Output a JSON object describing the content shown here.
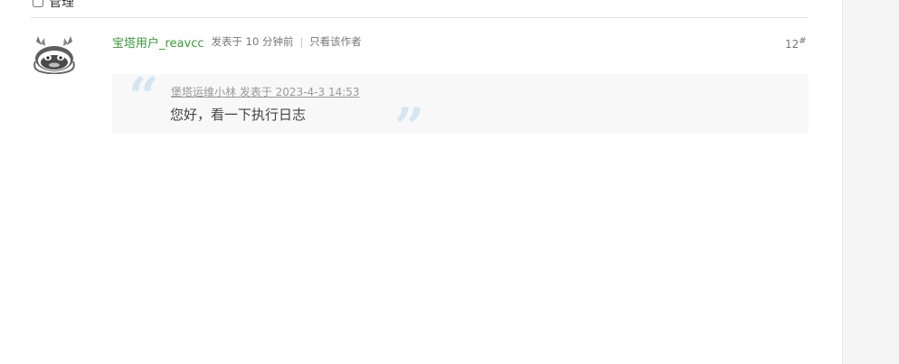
{
  "topbar": {
    "manage_label": "管理"
  },
  "post": {
    "author": "宝塔用户_reavcc",
    "posted_time": "发表于 10 分钟前",
    "separator": "|",
    "only_author_label": "只看该作者",
    "floor_number": "12",
    "floor_suffix": "#",
    "quote": {
      "ref_author": "堡塔运维小林",
      "ref_posted": "发表于 2023-4-3 14:53",
      "text": "您好，看一下执行日志"
    }
  },
  "colors": {
    "author_link": "#3c9a3c",
    "quote_marks": "#d6e5ef",
    "quote_bg": "#f8f8f8"
  },
  "icons": {
    "avatar": "cat-avatar-icon"
  }
}
